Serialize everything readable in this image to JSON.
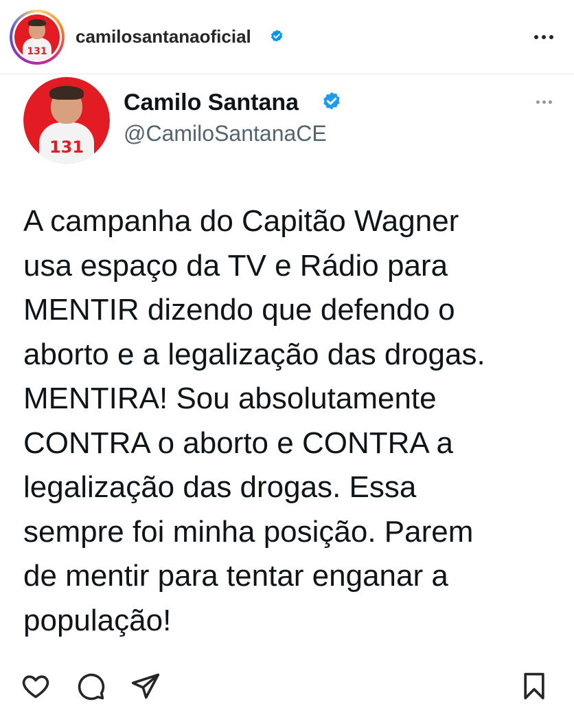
{
  "instagram_header": {
    "username": "camilosantanaoficial",
    "avatar_badge": "131"
  },
  "tweet": {
    "name": "Camilo Santana",
    "handle": "@CamiloSantanaCE",
    "avatar_badge": "131",
    "text": "A campanha do Capitão Wagner\nusa espaço da TV e Rádio para\nMENTIR dizendo que defendo o\naborto e a legalização das drogas.\nMENTIRA! Sou absolutamente\nCONTRA o aborto e CONTRA a\nlegalização das drogas. Essa\nsempre foi minha posição. Parem\nde mentir para tentar enganar a\npopulação!"
  },
  "actions": {
    "like_icon": "heart-icon",
    "comment_icon": "comment-icon",
    "share_icon": "send-icon",
    "save_icon": "bookmark-icon"
  },
  "colors": {
    "verified_blue": "#1d9bf0",
    "brand_red": "#e31b23"
  }
}
